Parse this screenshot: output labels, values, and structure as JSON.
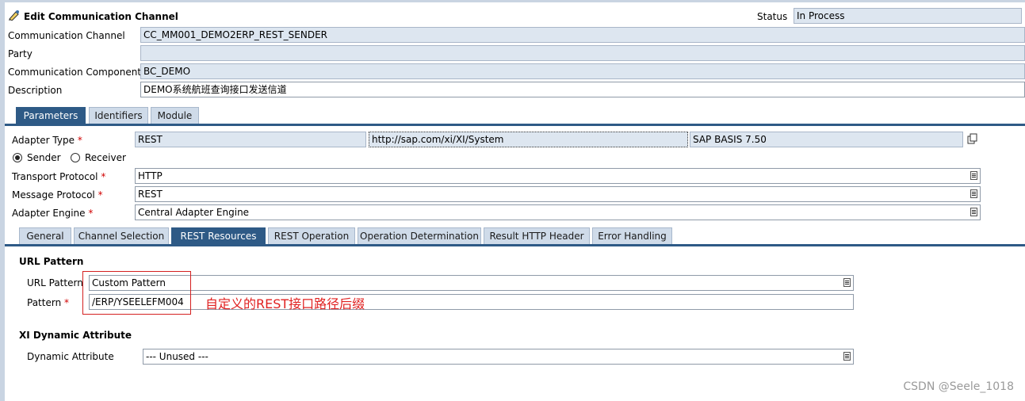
{
  "header": {
    "title": "Edit Communication Channel",
    "status_label": "Status",
    "status_value": "In Process"
  },
  "general": {
    "channel_label": "Communication Channel",
    "channel_value": "CC_MM001_DEMO2ERP_REST_SENDER",
    "party_label": "Party",
    "party_value": "",
    "component_label": "Communication Component",
    "component_value": "BC_DEMO",
    "description_label": "Description",
    "description_value": "DEMO系统航班查询接口发送信道"
  },
  "main_tabs": [
    "Parameters",
    "Identifiers",
    "Module"
  ],
  "parameters": {
    "adapter_type_label": "Adapter Type",
    "adapter_type_value": "REST",
    "adapter_namespace": "http://sap.com/xi/XI/System",
    "adapter_swcv": "SAP BASIS 7.50",
    "sender_label": "Sender",
    "receiver_label": "Receiver",
    "transport_label": "Transport Protocol",
    "transport_value": "HTTP",
    "message_label": "Message Protocol",
    "message_value": "REST",
    "engine_label": "Adapter Engine",
    "engine_value": "Central Adapter Engine",
    "required_mark": "*"
  },
  "sub_tabs": [
    "General",
    "Channel Selection",
    "REST Resources",
    "REST Operation",
    "Operation Determination",
    "Result HTTP Header",
    "Error Handling"
  ],
  "rest_resources": {
    "url_section_title": "URL Pattern",
    "url_pattern_label": "URL Pattern",
    "url_pattern_value": "Custom Pattern",
    "pattern_label": "Pattern",
    "pattern_value": "/ERP/YSEELEFM004",
    "annotation": "自定义的REST接口路径后缀",
    "dyn_section_title": "XI Dynamic Attribute",
    "dyn_label": "Dynamic Attribute",
    "dyn_value": "--- Unused ---"
  },
  "watermark": "CSDN @Seele_1018"
}
